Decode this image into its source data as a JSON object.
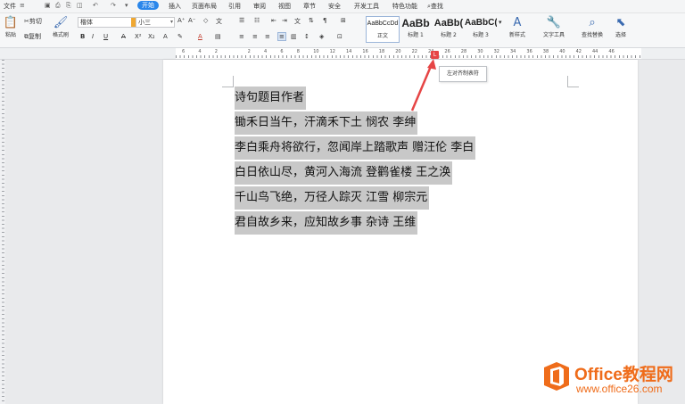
{
  "menubar": {
    "file": "文件",
    "tabs": [
      {
        "label": "开始",
        "active": true
      },
      {
        "label": "插入"
      },
      {
        "label": "页面布局"
      },
      {
        "label": "引用"
      },
      {
        "label": "审阅"
      },
      {
        "label": "视图"
      },
      {
        "label": "章节"
      },
      {
        "label": "安全"
      },
      {
        "label": "开发工具"
      },
      {
        "label": "特色功能"
      }
    ],
    "search": "查找"
  },
  "ribbon": {
    "paste": "粘贴",
    "cut": "剪切",
    "copy": "复制",
    "format_painter": "格式刷",
    "font_name": "楷体",
    "font_size": "小三",
    "styles": [
      {
        "sample": "AaBbCcDd",
        "label": "正文",
        "active": true
      },
      {
        "sample": "AaBb",
        "label": "标题 1"
      },
      {
        "sample": "AaBb(",
        "label": "标题 2"
      },
      {
        "sample": "AaBbC(",
        "label": "标题 3"
      }
    ],
    "new_style": "新样式",
    "text_tools": "文字工具",
    "find_replace": "查找替换",
    "select": "选择"
  },
  "ruler": {
    "numbers": [
      "6",
      "4",
      "2",
      "",
      "2",
      "4",
      "6",
      "8",
      "10",
      "12",
      "14",
      "16",
      "18",
      "20",
      "22",
      "24",
      "26",
      "28",
      "30",
      "32",
      "34",
      "36",
      "38",
      "40",
      "42",
      "44",
      "46"
    ]
  },
  "tab_stop_tooltip": "左对齐制表符",
  "document": {
    "lines": [
      "诗句题目作者",
      "锄禾日当午，汗滴禾下土 悯农 李绅",
      "李白乘舟将欲行，忽闻岸上踏歌声 赠汪伦 李白",
      "白日依山尽，黄河入海流 登鹳雀楼 王之涣",
      "千山鸟飞绝，万径人踪灭 江雪 柳宗元",
      "君自故乡来，应知故乡事 杂诗 王维"
    ]
  },
  "watermark": {
    "title": "Office教程网",
    "url": "www.office26.com"
  },
  "colors": {
    "accent": "#2a86ea",
    "selection": "#c8c8c8",
    "callout_red": "#e64545",
    "watermark_orange": "#ef6c1a"
  }
}
